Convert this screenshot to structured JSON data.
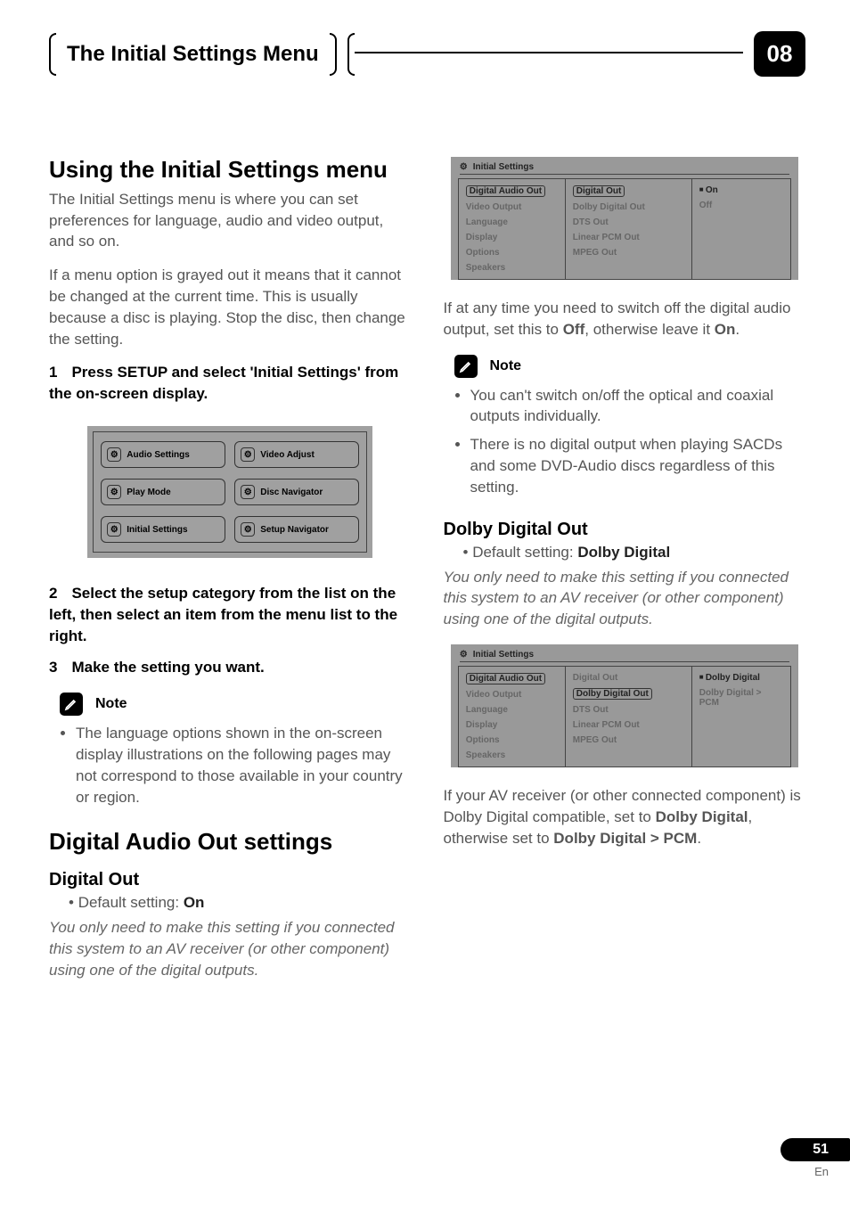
{
  "header": {
    "title": "The Initial Settings Menu",
    "chapter_number": "08"
  },
  "left_column": {
    "h1": "Using the Initial Settings menu",
    "intro1": "The Initial Settings menu is where you can set preferences for language, audio and video output, and so on.",
    "intro2": "If a menu option is grayed out it means that it cannot be changed at the current time. This is usually because a disc is playing. Stop the disc, then change the setting.",
    "step1_num": "1",
    "step1": "Press SETUP and select 'Initial Settings' from the on-screen display.",
    "osd_buttons": [
      "Audio Settings",
      "Video Adjust",
      "Play Mode",
      "Disc Navigator",
      "Initial Settings",
      "Setup Navigator"
    ],
    "step2_num": "2",
    "step2": "Select the setup category from the list on the left, then select an item from the menu list to the right.",
    "step3_num": "3",
    "step3": "Make the setting you want.",
    "note_label": "Note",
    "note_bullet": "The language options shown in the on-screen display illustrations on the following pages may not correspond to those available in your country or region.",
    "h1b": "Digital Audio Out settings",
    "h2": "Digital Out",
    "default_label": "Default setting:",
    "default_value": "On",
    "italic": "You only need to make this setting if you connected this system to an AV receiver (or other component) using one of the digital outputs."
  },
  "right_column": {
    "osd_title": "Initial Settings",
    "osd_left": [
      "Digital Audio Out",
      "Video Output",
      "Language",
      "Display",
      "Options",
      "Speakers"
    ],
    "osd_mid": [
      "Digital Out",
      "Dolby Digital Out",
      "DTS Out",
      "Linear PCM Out",
      "MPEG Out"
    ],
    "osd_right_1": [
      "On",
      "Off"
    ],
    "para1_a": "If at any time you need to switch off the digital audio output, set this to ",
    "para1_b": "Off",
    "para1_c": ", otherwise leave it ",
    "para1_d": "On",
    "para1_e": ".",
    "note_label": "Note",
    "note_bullet1": "You can't switch on/off the optical and coaxial outputs individually.",
    "note_bullet2": "There is no digital output when playing SACDs and some DVD-Audio discs regardless of this setting.",
    "h2": "Dolby Digital Out",
    "default_label": "Default setting:",
    "default_value": "Dolby Digital",
    "italic": "You only need to make this setting if you connected this system to an AV receiver (or other component) using one of the digital outputs.",
    "osd2_right": [
      "Dolby Digital",
      "Dolby Digital > PCM"
    ],
    "para2_a": "If your AV receiver (or other connected component) is Dolby Digital compatible, set to ",
    "para2_b": "Dolby Digital",
    "para2_c": ", otherwise set to ",
    "para2_d": "Dolby Digital > PCM",
    "para2_e": "."
  },
  "footer": {
    "page": "51",
    "lang": "En"
  }
}
